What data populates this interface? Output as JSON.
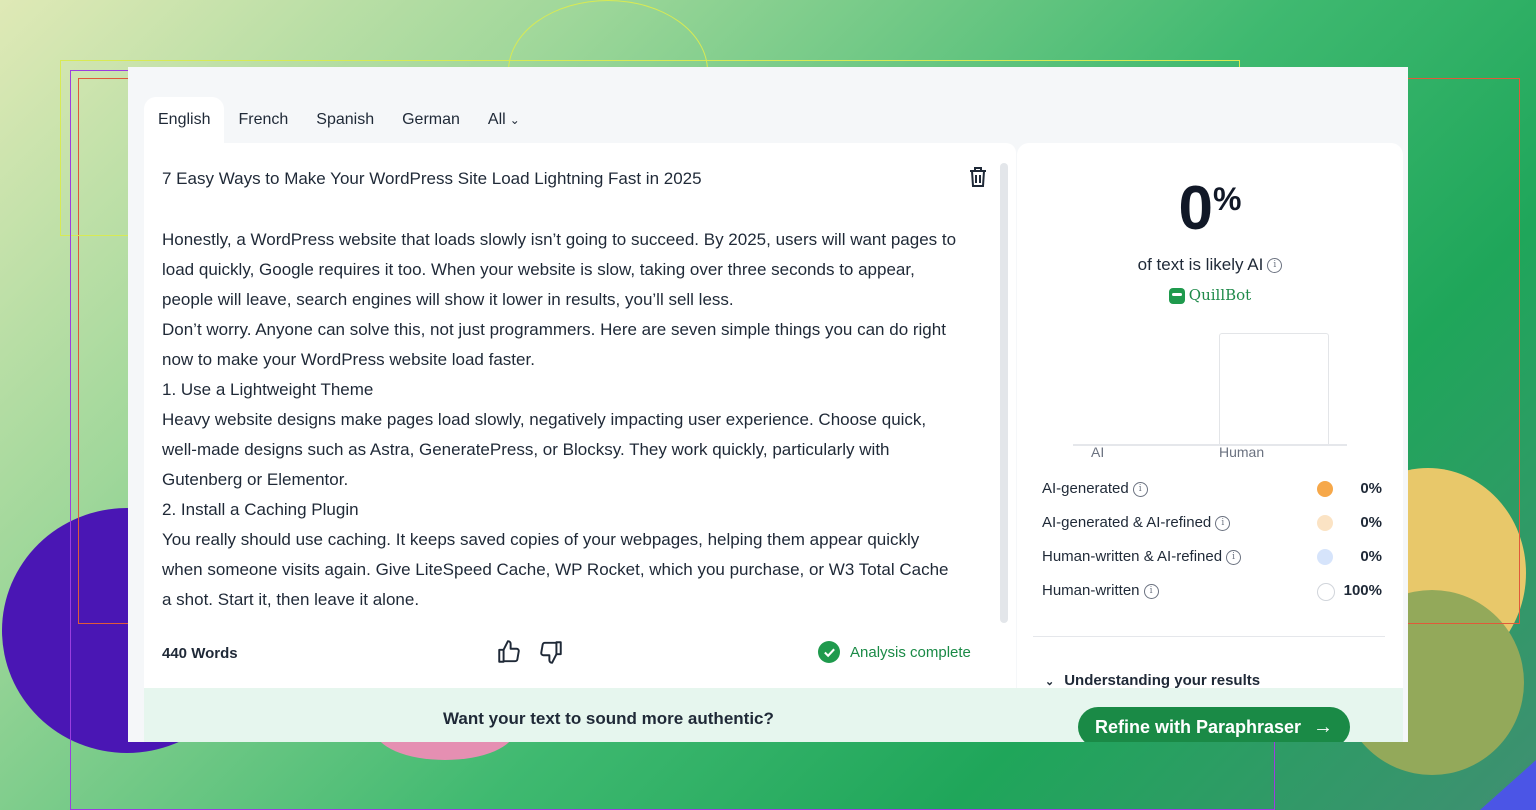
{
  "tabs": [
    {
      "label": "English",
      "active": true
    },
    {
      "label": "French"
    },
    {
      "label": "Spanish"
    },
    {
      "label": "German"
    },
    {
      "label": "All"
    }
  ],
  "editor": {
    "title": "7 Easy Ways to Make Your WordPress Site Load Lightning Fast in 2025",
    "paragraphs": [
      "Honestly, a WordPress website that loads slowly isn’t going to succeed. By 2025, users will want pages to load quickly, Google requires it too. When your website is slow, taking over three seconds to appear, people will leave, search engines will show it lower in results, you’ll sell less.",
      "Don’t worry. Anyone can solve this, not just programmers. Here are seven simple things you can do right now to make your WordPress website load faster.",
      "1. Use a Lightweight Theme",
      "Heavy website designs make pages load slowly, negatively impacting user experience. Choose quick, well-made designs such as Astra, GeneratePress, or Blocksy. They work quickly, particularly with Gutenberg or Elementor.",
      "2. Install a Caching Plugin",
      "You really should use caching. It keeps saved copies of your webpages, helping them appear quickly when someone visits again. Give LiteSpeed Cache, WP Rocket, which you purchase, or W3 Total Cache a shot. Start it, then leave it alone."
    ],
    "word_count": "440 Words",
    "status": "Analysis complete"
  },
  "result": {
    "percent": "0",
    "percent_sign": "%",
    "likely_text": "of text is likely AI",
    "brand": "QuillBot",
    "chart_labels": {
      "ai": "AI",
      "human": "Human"
    },
    "chart_values": {
      "ai": 0,
      "human": 100
    },
    "legend": [
      {
        "label": "AI-generated",
        "value": "0%",
        "color": "#f6a84a"
      },
      {
        "label": "AI-generated & AI-refined",
        "value": "0%",
        "color": "#fbe3c4"
      },
      {
        "label": "Human-written & AI-refined",
        "value": "0%",
        "color": "#d6e4fb"
      },
      {
        "label": "Human-written",
        "value": "100%",
        "color": "#ffffff"
      }
    ],
    "understanding": "Understanding your results"
  },
  "banner": {
    "text": "Want your text to sound more authentic?",
    "button": "Refine with Paraphraser"
  }
}
